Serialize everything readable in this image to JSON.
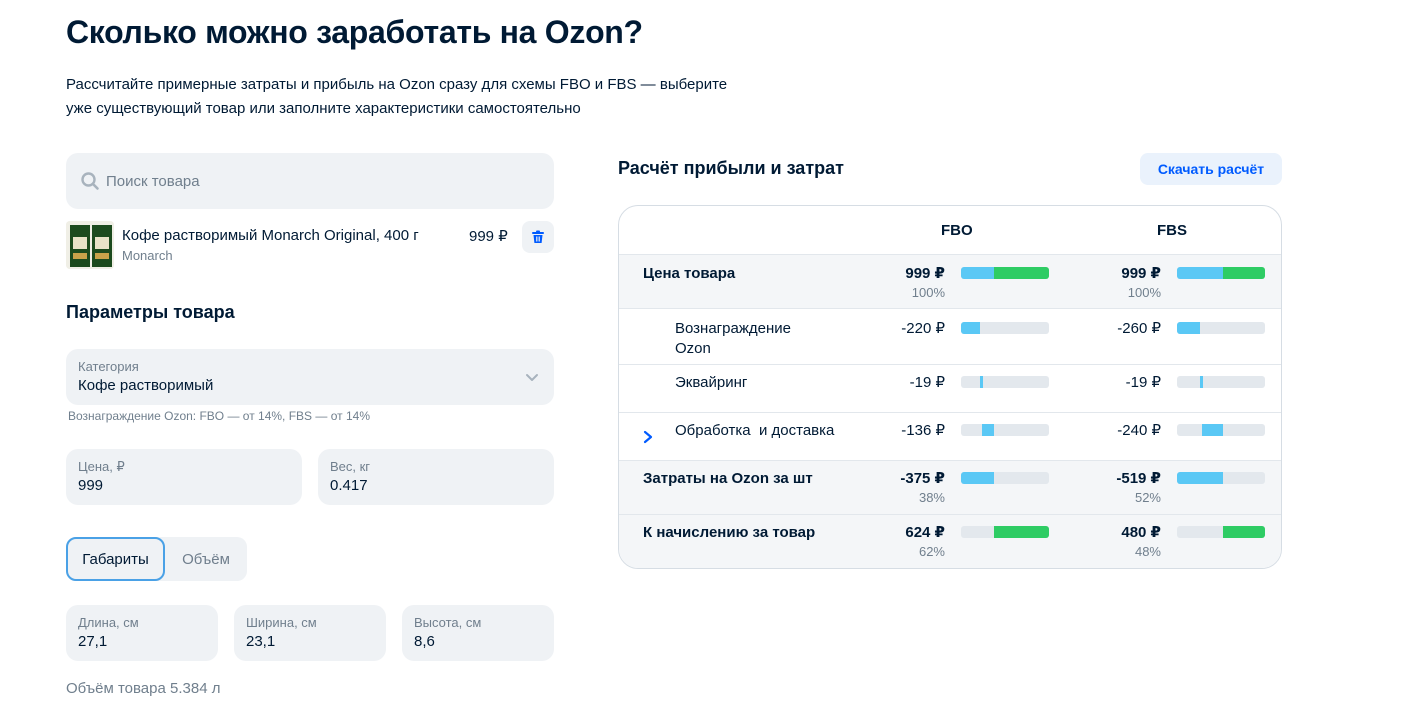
{
  "page": {
    "title": "Сколько можно заработать на Ozon?",
    "subtitle_line1": "Рассчитайте примерные затраты и прибыль на Ozon сразу для схемы FBO и FBS — выберите",
    "subtitle_line2": "уже существующий товар или заполните характеристики самостоятельно"
  },
  "search": {
    "placeholder": "Поиск товара",
    "icon": "search-icon"
  },
  "product": {
    "name": "Кофе растворимый Monarch Original, 400 г",
    "brand": "Monarch",
    "price": "999 ₽",
    "delete_icon": "trash-icon"
  },
  "params": {
    "title": "Параметры товара",
    "category_label": "Категория",
    "category_value": "Кофе растворимый",
    "commission_hint": "Вознаграждение Ozon: FBO — от 14%, FBS — от 14%",
    "price_label": "Цена, ₽",
    "price_value": "999",
    "weight_label": "Вес, кг",
    "weight_value": "0.417",
    "tabs": [
      "Габариты",
      "Объём"
    ],
    "active_tab": "Габариты",
    "length_label": "Длина, см",
    "length_value": "27,1",
    "width_label": "Ширина, см",
    "width_value": "23,1",
    "height_label": "Высота, см",
    "height_value": "8,6",
    "volume_text": "Объём товара 5.384 л"
  },
  "calc": {
    "title": "Расчёт прибыли и затрат",
    "download_label": "Скачать расчёт",
    "columns": [
      "FBO",
      "FBS"
    ],
    "colors": {
      "cost": "#5ac8f5",
      "profit": "#2ecc64",
      "track": "#e3e8ed"
    },
    "rows": [
      {
        "label": "Цена товара",
        "bold": true,
        "shaded": true,
        "fbo": {
          "amount": "999 ₽",
          "pct": "100%",
          "share_cost": 0.38,
          "share_profit": 0.62
        },
        "fbs": {
          "amount": "999 ₽",
          "pct": "100%",
          "share_cost": 0.52,
          "share_profit": 0.48
        }
      },
      {
        "label": "Вознаграждение Ozon",
        "label_line1": "Вознаграждение",
        "label_line2": "Ozon",
        "indent": true,
        "fbo": {
          "amount": "-220 ₽",
          "offset": 0,
          "share": 0.22
        },
        "fbs": {
          "amount": "-260 ₽",
          "offset": 0,
          "share": 0.26
        }
      },
      {
        "label": "Эквайринг",
        "indent": true,
        "fbo": {
          "amount": "-19 ₽",
          "offset": 0.22,
          "share": 0.02
        },
        "fbs": {
          "amount": "-19 ₽",
          "offset": 0.26,
          "share": 0.02
        }
      },
      {
        "label": "Обработка  и доставка",
        "indent": true,
        "expandable": true,
        "fbo": {
          "amount": "-136 ₽",
          "offset": 0.24,
          "share": 0.14
        },
        "fbs": {
          "amount": "-240 ₽",
          "offset": 0.28,
          "share": 0.24
        }
      },
      {
        "label": "Затраты на Ozon за шт",
        "bold": true,
        "shaded": true,
        "fbo": {
          "amount": "-375 ₽",
          "pct": "38%",
          "share": 0.38
        },
        "fbs": {
          "amount": "-519 ₽",
          "pct": "52%",
          "share": 0.52
        }
      },
      {
        "label": "К начислению за товар",
        "bold": true,
        "shaded": true,
        "fbo": {
          "amount": "624 ₽",
          "pct": "62%",
          "offset": 0.38,
          "share": 0.62
        },
        "fbs": {
          "amount": "480 ₽",
          "pct": "48%",
          "offset": 0.52,
          "share": 0.48
        }
      }
    ]
  }
}
